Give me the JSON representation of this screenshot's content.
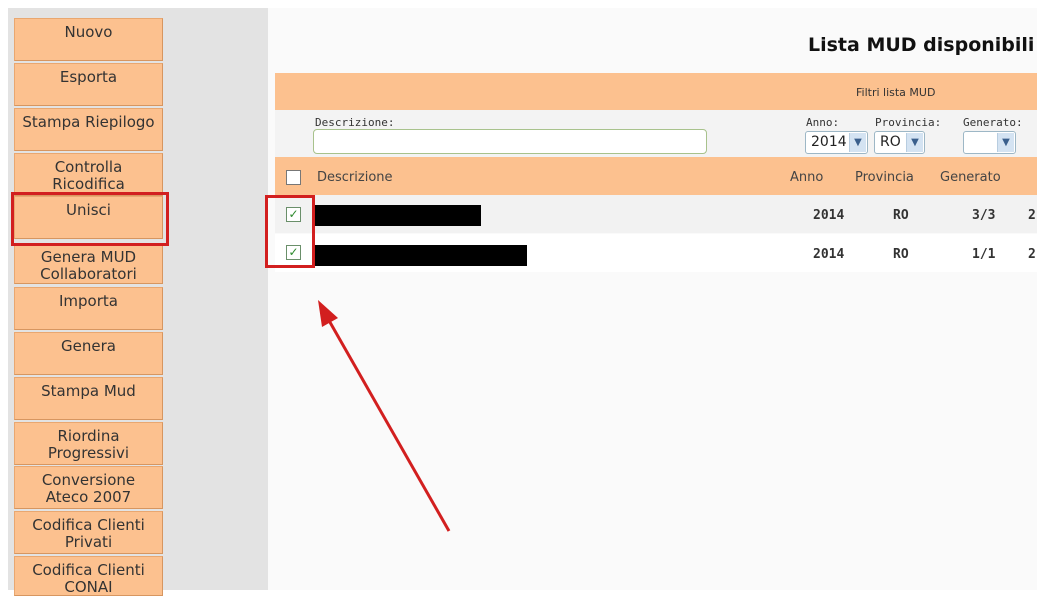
{
  "sidebar": {
    "buttons": [
      {
        "label": "Nuovo"
      },
      {
        "label": "Esporta"
      },
      {
        "label": "Stampa Riepilogo"
      },
      {
        "label": "Controlla Ricodifica"
      },
      {
        "label": "Unisci"
      },
      {
        "label": "Genera MUD Collaboratori"
      },
      {
        "label": "Importa"
      },
      {
        "label": "Genera"
      },
      {
        "label": "Stampa Mud"
      },
      {
        "label": "Riordina Progressivi"
      },
      {
        "label": "Conversione Ateco 2007"
      },
      {
        "label": "Codifica Clienti Privati"
      },
      {
        "label": "Codifica Clienti CONAI"
      }
    ]
  },
  "main": {
    "title": "Lista MUD disponibili",
    "filters": {
      "title": "Filtri lista MUD",
      "descrizione_label": "Descrizione:",
      "descrizione_value": "",
      "anno_label": "Anno:",
      "anno_value": "2014",
      "provincia_label": "Provincia:",
      "provincia_value": "RO",
      "generato_label": "Generato:",
      "generato_value": ""
    },
    "table": {
      "headers": {
        "descrizione": "Descrizione",
        "anno": "Anno",
        "provincia": "Provincia",
        "generato": "Generato"
      },
      "rows": [
        {
          "checked": true,
          "anno": "2014",
          "provincia": "RO",
          "generato": "3/3",
          "extra": "2"
        },
        {
          "checked": true,
          "anno": "2014",
          "provincia": "RO",
          "generato": "1/1",
          "extra": "2"
        }
      ]
    }
  },
  "annotations": {
    "highlight_color": "#d21f1f",
    "arrow_color": "#d21f1f"
  }
}
